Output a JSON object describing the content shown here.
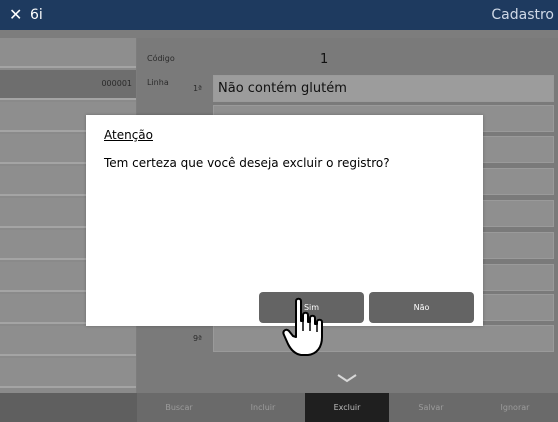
{
  "window": {
    "close_glyph": "✕",
    "app_title": "6i",
    "screen_title": "Cadastro"
  },
  "list": {
    "rows": [
      {
        "code": ""
      },
      {
        "code": "000001"
      },
      {
        "code": ""
      },
      {
        "code": ""
      },
      {
        "code": ""
      },
      {
        "code": ""
      },
      {
        "code": ""
      },
      {
        "code": ""
      },
      {
        "code": ""
      },
      {
        "code": ""
      },
      {
        "code": ""
      }
    ]
  },
  "form": {
    "codigo_label": "Código",
    "codigo_value": "1",
    "linha_label": "Linha",
    "first_ordinal": "1ª",
    "first_line": "Não contém glutém",
    "last_ordinal": "9ª"
  },
  "toolbar": {
    "buscar": "Buscar",
    "incluir": "Incluir",
    "excluir": "Excluir",
    "salvar": "Salvar",
    "ignorar": "Ignorar"
  },
  "dialog": {
    "title": "Atenção",
    "message": "Tem certeza que você deseja excluir o registro?",
    "yes_label": "Sim",
    "no_label": "Não"
  },
  "colors": {
    "topbar": "#1e3a5f",
    "dialog_button": "#646464",
    "active_toolbar": "#1f1f1f"
  },
  "icons": {
    "close": "close-icon",
    "more": "chevron-down-icon",
    "pointer": "hand-pointer-icon"
  }
}
